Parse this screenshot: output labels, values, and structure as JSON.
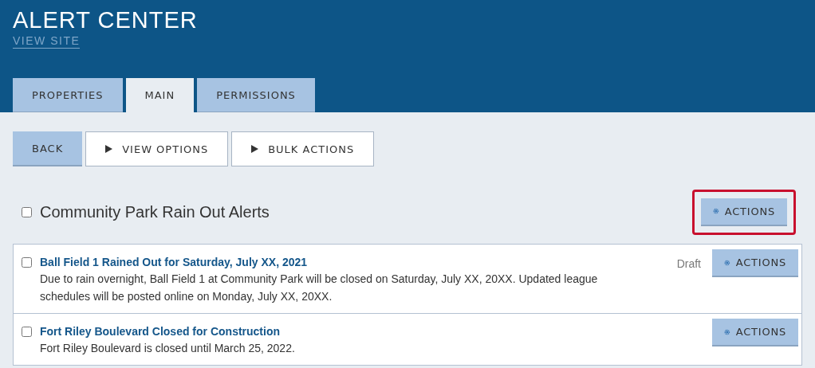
{
  "header": {
    "title": "ALERT CENTER",
    "link": "VIEW SITE"
  },
  "tabs": [
    {
      "label": "PROPERTIES",
      "selected": false
    },
    {
      "label": "MAIN",
      "selected": true
    },
    {
      "label": "PERMISSIONS",
      "selected": false
    }
  ],
  "toolbar": [
    {
      "label": "BACK",
      "kind": "primary"
    },
    {
      "label": "VIEW OPTIONS",
      "kind": "toggle",
      "expanded": false
    },
    {
      "label": "BULK ACTIONS",
      "kind": "toggle",
      "expanded": false
    }
  ],
  "group": {
    "title": "Community Park Rain Out Alerts",
    "checked": false,
    "action": "ACTIONS",
    "highlighted": true
  },
  "alerts": [
    {
      "title": "Ball Field 1 Rained Out for Saturday, July XX, 2021",
      "body": "Due to rain overnight, Ball Field 1 at Community Park will be closed on Saturday, July XX, 20XX. Updated league schedules will be posted online on Monday, July XX, 20XX.",
      "status": "Draft",
      "checked": false,
      "action": "ACTIONS"
    },
    {
      "title": "Fort Riley Boulevard Closed for Construction",
      "body": "Fort Riley Boulevard is closed until March 25, 2022.",
      "checked": false,
      "action": "ACTIONS"
    }
  ]
}
